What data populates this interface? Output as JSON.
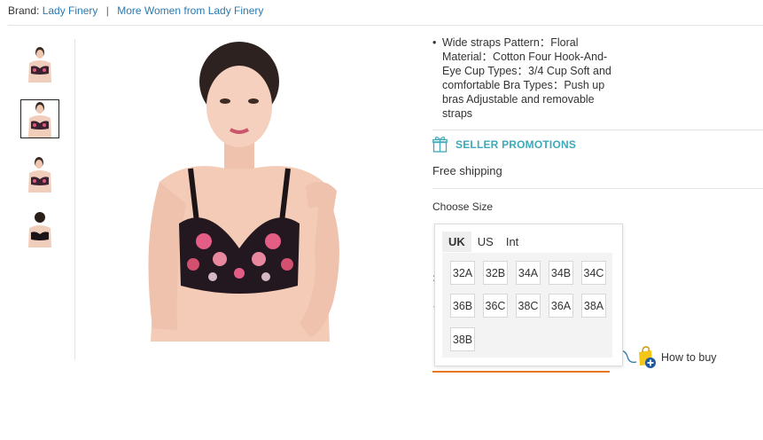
{
  "brand_bar": {
    "prefix": "Brand:",
    "brand_name": "Lady Finery",
    "separator": "|",
    "more_link": "More Women from Lady Finery"
  },
  "description": {
    "bullet": "•",
    "text": "Wide straps Pattern：Floral Material：Cotton Four Hook-And-Eye Cup Types：3/4 Cup Soft and comfortable Bra Types：Push up bras Adjustable and removable straps"
  },
  "promotions": {
    "label": "SELLER PROMOTIONS",
    "icon": "gift-icon",
    "shipping": "Free shipping"
  },
  "size": {
    "title": "Choose Size",
    "tabs": [
      "UK",
      "US",
      "Int"
    ],
    "active_tab": "UK",
    "options": [
      "32A",
      "32B",
      "34A",
      "34B",
      "34C",
      "36B",
      "36C",
      "38C",
      "36A",
      "38A",
      "38B"
    ]
  },
  "how_to_buy": "How to buy",
  "colors": {
    "link": "#2a7ab0",
    "promo": "#3fa9b9",
    "buy_button": "#e8781f"
  }
}
